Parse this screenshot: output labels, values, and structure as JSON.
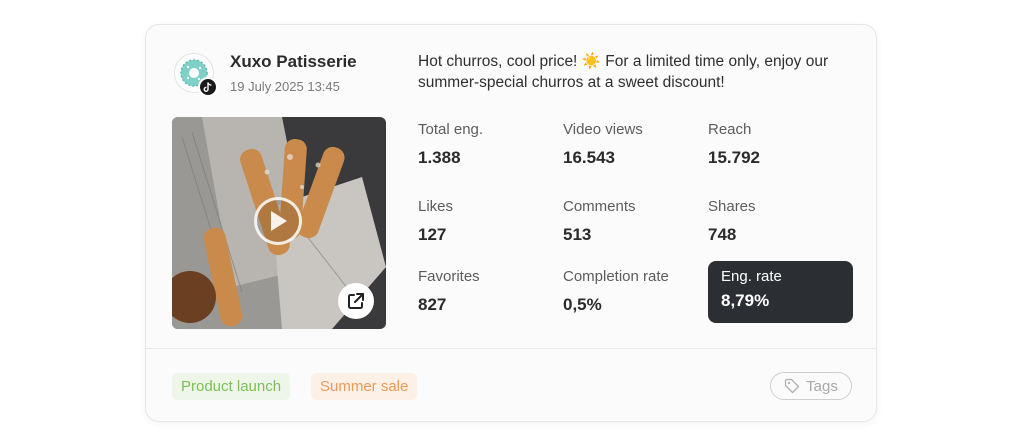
{
  "post": {
    "account_name": "Xuxo Patisserie",
    "platform_icon": "tiktok-icon",
    "date": "19 July 2025 13:45",
    "caption": "Hot churros, cool price! ☀️ For a limited time only, enjoy our summer-special churros at a sweet discount!"
  },
  "metrics": [
    {
      "label": "Total eng.",
      "value": "1.388"
    },
    {
      "label": "Video views",
      "value": "16.543"
    },
    {
      "label": "Reach",
      "value": "15.792"
    },
    {
      "label": "Likes",
      "value": "127"
    },
    {
      "label": "Comments",
      "value": "513"
    },
    {
      "label": "Shares",
      "value": "748"
    },
    {
      "label": "Favorites",
      "value": "827"
    },
    {
      "label": "Completion rate",
      "value": "0,5%"
    },
    {
      "label": "Eng. rate",
      "value": "8,79%"
    }
  ],
  "tags": [
    {
      "label": "Product launch",
      "color": "#7cbf54"
    },
    {
      "label": "Summer sale",
      "color": "#ef9a55"
    }
  ],
  "tags_button": {
    "label": "Tags",
    "icon": "tag-icon"
  },
  "colors": {
    "highlight_bg": "#2b2f33",
    "card_bg": "#fbfbfb"
  }
}
